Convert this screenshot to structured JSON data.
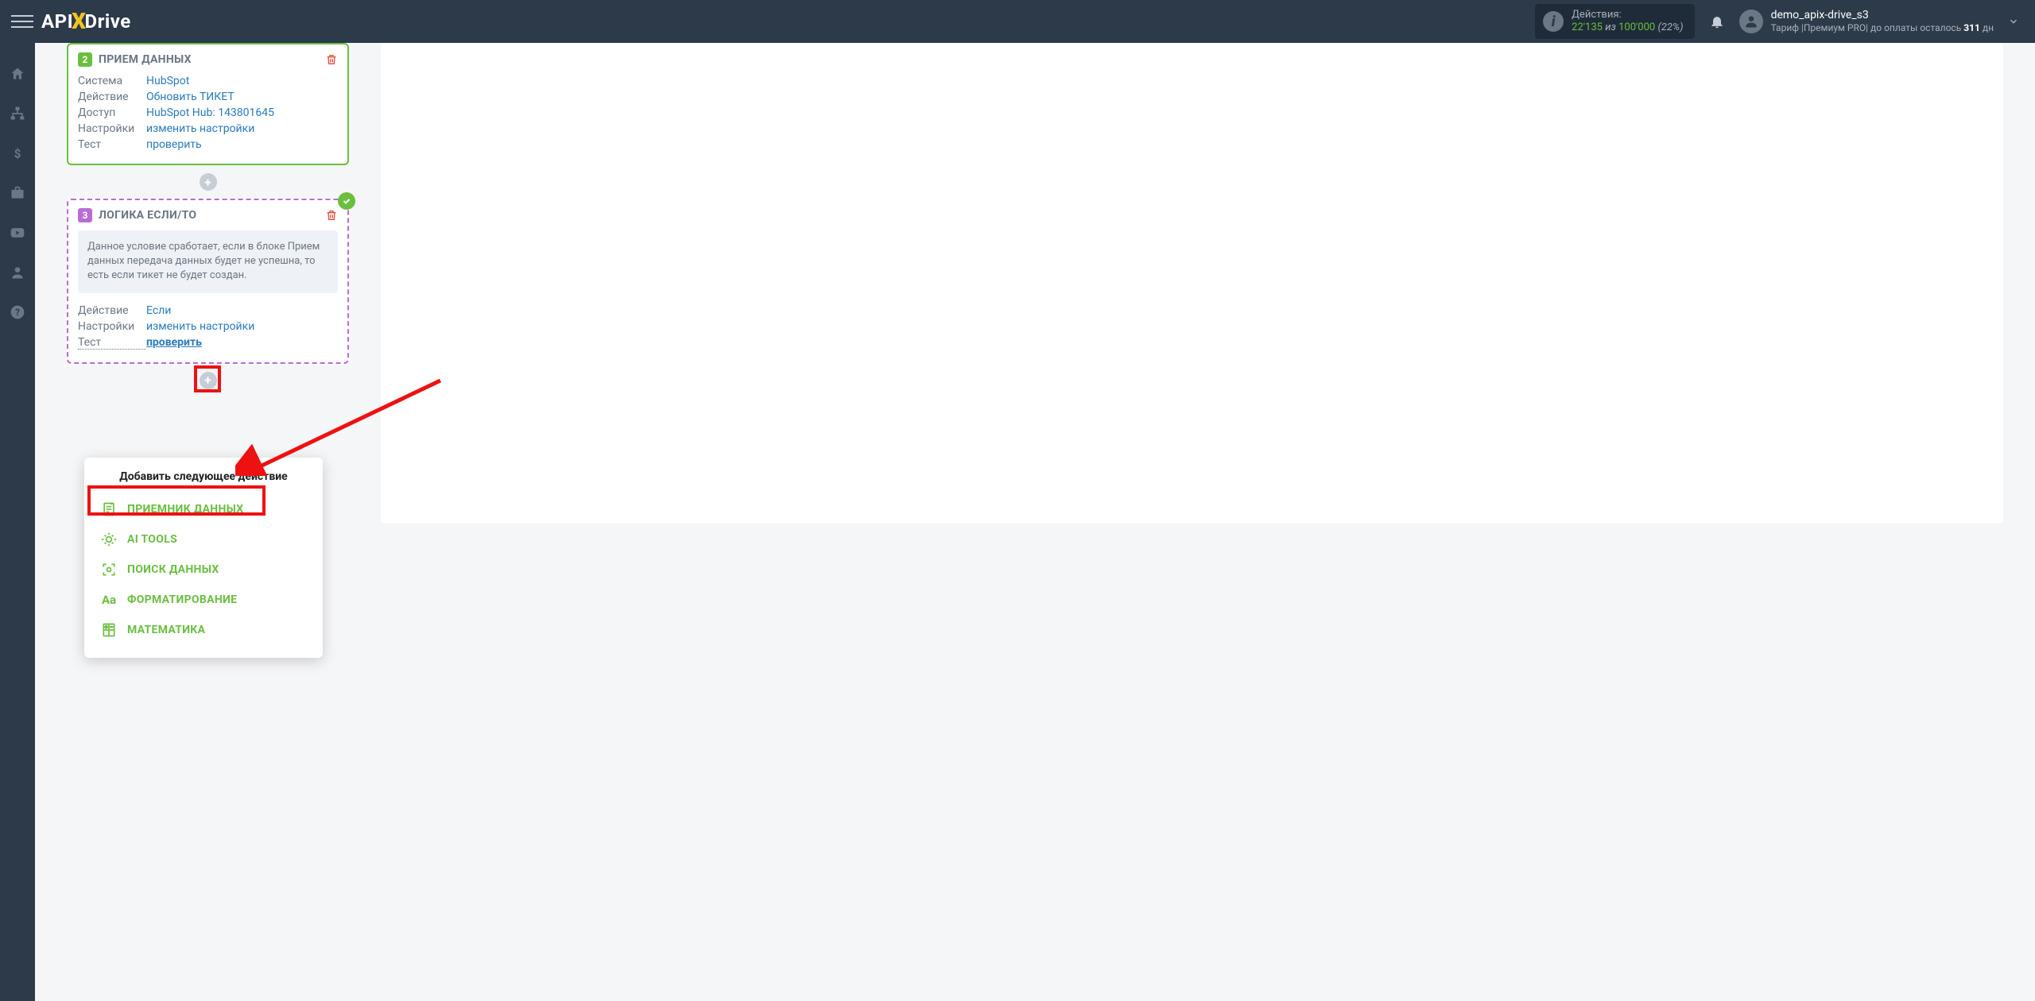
{
  "header": {
    "logo_api": "API",
    "logo_drive": "Drive",
    "actions_label": "Действия:",
    "actions_count": "22'135",
    "actions_of": "из",
    "actions_total": "100'000",
    "actions_pct": "(22%)",
    "username": "demo_apix-drive_s3",
    "plan_prefix": "Тариф |",
    "plan_name": "Премиум PRO",
    "plan_suffix": "| до оплаты осталось ",
    "days": "311",
    "days_unit": " дн"
  },
  "step2": {
    "num": "2",
    "title": "ПРИЕМ ДАННЫХ",
    "rows": {
      "system_label": "Система",
      "system_value": "HubSpot",
      "action_label": "Действие",
      "action_value": "Обновить ТИКЕТ",
      "access_label": "Доступ",
      "access_value": "HubSpot Hub: 143801645",
      "settings_label": "Настройки",
      "settings_value": "изменить настройки",
      "test_label": "Тест",
      "test_value": "проверить"
    }
  },
  "step3": {
    "num": "3",
    "title": "ЛОГИКА ЕСЛИ/ТО",
    "info": "Данное условие сработает, если в блоке Прием данных передача данных будет не успешна, то есть если тикет не будет создан.",
    "rows": {
      "action_label": "Действие",
      "action_value": "Если",
      "settings_label": "Настройки",
      "settings_value": "изменить настройки",
      "test_label": "Тест",
      "test_value": "проверить"
    }
  },
  "dropdown": {
    "title": "Добавить следующее действие",
    "items": {
      "receiver": "ПРИЕМНИК ДАННЫХ",
      "ai": "AI TOOLS",
      "search": "ПОИСК ДАННЫХ",
      "format": "ФОРМАТИРОВАНИЕ",
      "math": "МАТЕМАТИКА"
    }
  }
}
